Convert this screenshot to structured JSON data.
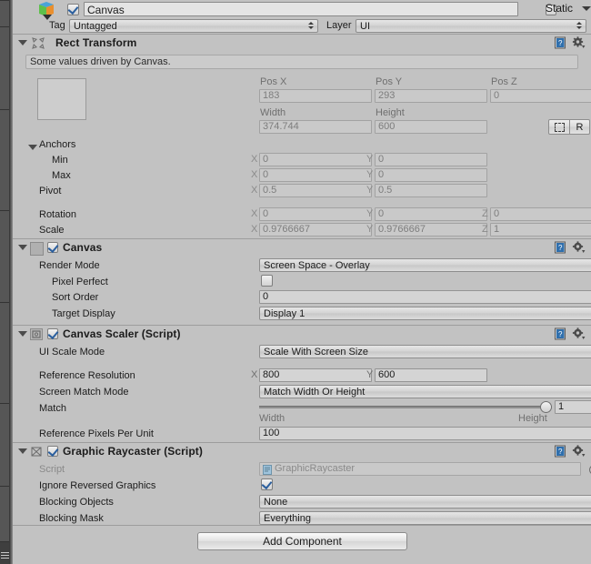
{
  "window": {
    "object_name": "Canvas",
    "object_enabled": true,
    "static_label": "Static",
    "static_checked": false,
    "tag_label": "Tag",
    "tag_value": "Untagged",
    "layer_label": "Layer",
    "layer_value": "UI"
  },
  "rect_transform": {
    "title": "Rect Transform",
    "info": "Some values driven by Canvas.",
    "pos_x_label": "Pos X",
    "pos_y_label": "Pos Y",
    "pos_z_label": "Pos Z",
    "pos_x": "183",
    "pos_y": "293",
    "pos_z": "0",
    "width_label": "Width",
    "height_label": "Height",
    "width": "374.744",
    "height": "600",
    "anchors_label": "Anchors",
    "min_label": "Min",
    "max_label": "Max",
    "pivot_label": "Pivot",
    "rotation_label": "Rotation",
    "scale_label": "Scale",
    "axis_x": "X",
    "axis_y": "Y",
    "axis_z": "Z",
    "anchor_min_x": "0",
    "anchor_min_y": "0",
    "anchor_max_x": "0",
    "anchor_max_y": "0",
    "pivot_x": "0.5",
    "pivot_y": "0.5",
    "rotation_x": "0",
    "rotation_y": "0",
    "rotation_z": "0",
    "scale_x": "0.9766667",
    "scale_y": "0.9766667",
    "scale_z": "1",
    "blueprint_button": "R"
  },
  "canvas": {
    "title": "Canvas",
    "enabled": true,
    "render_mode_label": "Render Mode",
    "render_mode_value": "Screen Space - Overlay",
    "pixel_perfect_label": "Pixel Perfect",
    "pixel_perfect_checked": false,
    "sort_order_label": "Sort Order",
    "sort_order_value": "0",
    "target_display_label": "Target Display",
    "target_display_value": "Display 1"
  },
  "canvas_scaler": {
    "title": "Canvas Scaler (Script)",
    "enabled": true,
    "ui_scale_mode_label": "UI Scale Mode",
    "ui_scale_mode_value": "Scale With Screen Size",
    "reference_resolution_label": "Reference Resolution",
    "axis_x": "X",
    "axis_y": "Y",
    "reference_resolution_x": "800",
    "reference_resolution_y": "600",
    "screen_match_mode_label": "Screen Match Mode",
    "screen_match_mode_value": "Match Width Or Height",
    "match_label": "Match",
    "match_value": "1",
    "match_min_label": "Width",
    "match_max_label": "Height",
    "reference_ppu_label": "Reference Pixels Per Unit",
    "reference_ppu_value": "100"
  },
  "graphic_raycaster": {
    "title": "Graphic Raycaster (Script)",
    "enabled": true,
    "script_label": "Script",
    "script_value": "GraphicRaycaster",
    "ignore_reversed_label": "Ignore Reversed Graphics",
    "ignore_reversed_checked": true,
    "blocking_objects_label": "Blocking Objects",
    "blocking_objects_value": "None",
    "blocking_mask_label": "Blocking Mask",
    "blocking_mask_value": "Everything"
  },
  "footer": {
    "add_component_label": "Add Component"
  }
}
